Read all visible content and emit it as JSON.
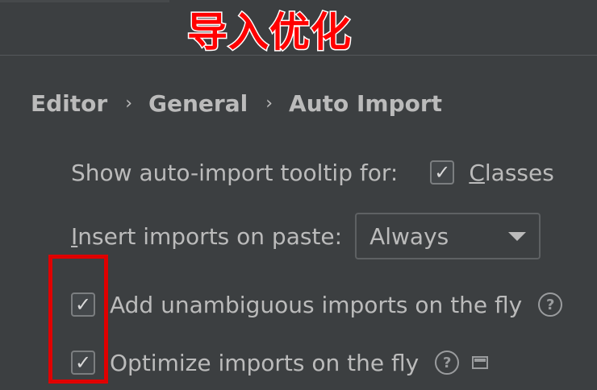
{
  "overlay": {
    "title": "导入优化",
    "color": "#ff0000"
  },
  "breadcrumb": {
    "items": [
      "Editor",
      "General",
      "Auto Import"
    ],
    "separator": "›"
  },
  "settings": {
    "tooltip_row": {
      "label": "Show auto-import tooltip for:",
      "checkbox_label_first": "C",
      "checkbox_label_rest": "lasses",
      "checked": true
    },
    "paste_row": {
      "label_first": "I",
      "label_rest": "nsert imports on paste:",
      "selected": "Always"
    },
    "unambiguous_row": {
      "label": "Add unambiguous imports on the fly",
      "checked": true
    },
    "optimize_row": {
      "label": "Optimize imports on the fly",
      "checked": true
    }
  },
  "icons": {
    "check": "✓",
    "help": "?"
  },
  "colors": {
    "background": "#3c3f41",
    "text": "#bbbbbb",
    "highlight": "#e00000"
  }
}
